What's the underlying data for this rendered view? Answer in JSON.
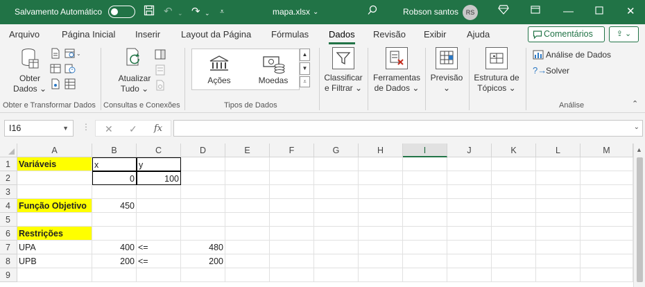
{
  "titlebar": {
    "autosave_label": "Salvamento Automático",
    "file_name": "mapa.xlsx",
    "user_name": "Robson santos",
    "user_initials": "RS"
  },
  "tabs": [
    "Arquivo",
    "Página Inicial",
    "Inserir",
    "Layout da Página",
    "Fórmulas",
    "Dados",
    "Revisão",
    "Exibir",
    "Ajuda"
  ],
  "active_tab": "Dados",
  "comments_label": "Comentários",
  "ribbon": {
    "obter_dados": [
      "Obter",
      "Dados"
    ],
    "atualizar_tudo": [
      "Atualizar",
      "Tudo"
    ],
    "acoes": "Ações",
    "moedas": "Moedas",
    "classificar": [
      "Classificar",
      "e Filtrar"
    ],
    "ferramentas": [
      "Ferramentas",
      "de Dados"
    ],
    "previsao": "Previsão",
    "estrutura": [
      "Estrutura de",
      "Tópicos"
    ],
    "analise_dados": "Análise de Dados",
    "solver": "Solver",
    "groups": {
      "obter": "Obter e Transformar Dados",
      "consultas": "Consultas e Conexões",
      "tipos": "Tipos de Dados",
      "analise": "Análise"
    }
  },
  "formula_bar": {
    "name_box": "I16",
    "formula": ""
  },
  "columns": [
    "A",
    "B",
    "C",
    "D",
    "E",
    "F",
    "G",
    "H",
    "I",
    "J",
    "K",
    "L",
    "M"
  ],
  "selected_column": "I",
  "rows": [
    "1",
    "2",
    "3",
    "4",
    "5",
    "6",
    "7",
    "8",
    "9"
  ],
  "cells": {
    "A1": "Variáveis",
    "B1": "x",
    "C1": "y",
    "B2": "0",
    "C2": "100",
    "A4": "Função Objetivo",
    "B4": "450",
    "A6": "Restrições",
    "A7": "UPA",
    "B7": "400",
    "C7": "<=",
    "D7": "480",
    "A8": "UPB",
    "B8": "200",
    "C8": "<=",
    "D8": "200"
  },
  "colors": {
    "excel_green": "#217346",
    "highlight_yellow": "#ffff00"
  }
}
